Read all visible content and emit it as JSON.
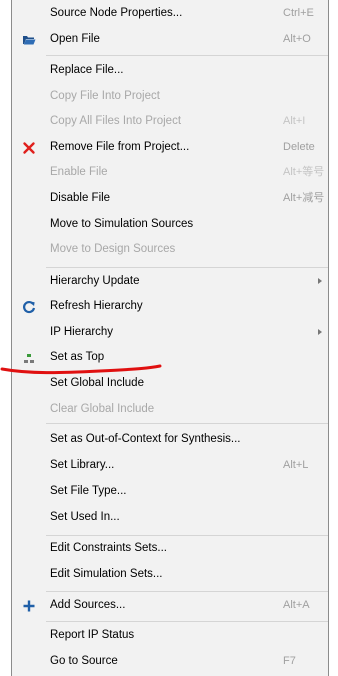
{
  "menu": {
    "items": [
      {
        "label": "Source Node Properties...",
        "shortcut": "Ctrl+E"
      },
      {
        "label": "Open File",
        "shortcut": "Alt+O",
        "icon": "folder-open-icon"
      },
      {
        "label": "Replace File..."
      },
      {
        "label": "Copy File Into Project",
        "disabled": true
      },
      {
        "label": "Copy All Files Into Project",
        "shortcut": "Alt+I",
        "disabled": true
      },
      {
        "label": "Remove File from Project...",
        "shortcut": "Delete",
        "icon": "remove-x-icon"
      },
      {
        "label": "Enable File",
        "shortcut": "Alt+等号",
        "disabled": true
      },
      {
        "label": "Disable File",
        "shortcut": "Alt+减号"
      },
      {
        "label": "Move to Simulation Sources"
      },
      {
        "label": "Move to Design Sources",
        "disabled": true
      },
      {
        "label": "Hierarchy Update",
        "submenu": true
      },
      {
        "label": "Refresh Hierarchy",
        "icon": "refresh-icon"
      },
      {
        "label": "IP Hierarchy",
        "submenu": true
      },
      {
        "label": "Set as Top",
        "icon": "hierarchy-top-icon"
      },
      {
        "label": "Set Global Include"
      },
      {
        "label": "Clear Global Include",
        "disabled": true
      },
      {
        "label": "Set as Out-of-Context for Synthesis..."
      },
      {
        "label": "Set Library...",
        "shortcut": "Alt+L"
      },
      {
        "label": "Set File Type..."
      },
      {
        "label": "Set Used In..."
      },
      {
        "label": "Edit Constraints Sets..."
      },
      {
        "label": "Edit Simulation Sets..."
      },
      {
        "label": "Add Sources...",
        "shortcut": "Alt+A",
        "icon": "add-plus-icon"
      },
      {
        "label": "Report IP Status"
      },
      {
        "label": "Go to Source",
        "shortcut": "F7"
      }
    ]
  },
  "colors": {
    "menu_bg": "#f2f2f2",
    "separator": "#d5d5d5",
    "icon_blue": "#2060a8",
    "remove_red": "#e0201c",
    "annotation_red": "#e01010"
  }
}
